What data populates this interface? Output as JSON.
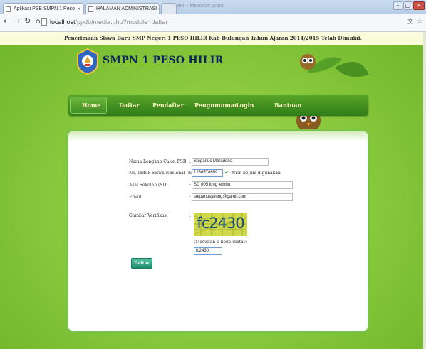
{
  "browser": {
    "tabs": [
      {
        "label": "Aplikasi PSB SMPN 1 Peso"
      },
      {
        "label": "HALAMAN ADMINISTRASI"
      }
    ],
    "window_title": "Bett - Microsoft Word",
    "url_host": "localhost",
    "url_path": "/ppdb/media.php?module=daftar"
  },
  "banner": {
    "text": "Penerimaan Siswa Baru SMP Negeri 1 PESO HILIR Kab Bulungan Tahun Ajaran 2014/2015 Telah Dimulai."
  },
  "site": {
    "title": "SMPN 1 PESO HILIR"
  },
  "nav": {
    "items": [
      "Home",
      "Daftar",
      "Pendaftar",
      "Pengumuman",
      "Login",
      "Bantuan"
    ]
  },
  "form": {
    "nama_label": "Nama Lengkap Calon PSB",
    "nama_value": "Stepanus Maradona",
    "nisn_label": "No. Induk Siswa Nasional (NISN)",
    "nisn_value": "1236578659",
    "nisn_status": "Nisn belum digunakan",
    "asal_label": "Asal Sekolah (SD)",
    "asal_value": "SD 005 long lembu",
    "email_label": "Email",
    "email_value": "stepanusjalung@gamil.com",
    "captcha_label": "Gambar Verifikasi",
    "captcha_image_text": "fc2430",
    "captcha_hint": "(Masukan 6 kode diatas)",
    "captcha_value": "fc2430",
    "submit_label": "Daftar"
  },
  "colors": {
    "background": "#7fc23a",
    "nav": "#3f8e22",
    "title": "#0d2360",
    "button": "#1d8c70"
  }
}
